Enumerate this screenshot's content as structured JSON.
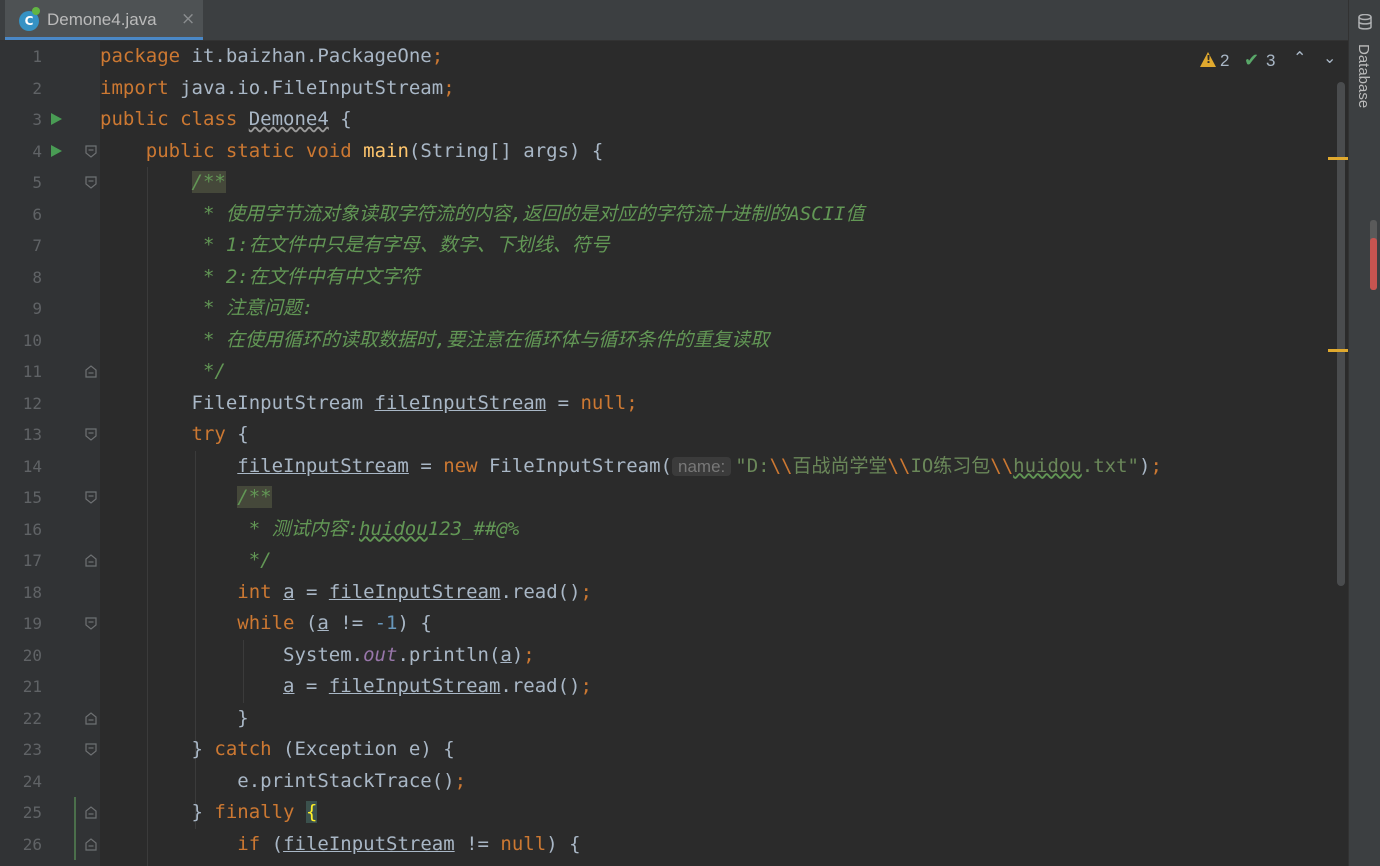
{
  "tab": {
    "filename": "Demone4.java",
    "close": "×",
    "icon": "java-class-icon"
  },
  "inspections": {
    "warnings": "2",
    "ok": "3",
    "up": "⌃",
    "down": "⌄"
  },
  "sidebar": {
    "label": "Database"
  },
  "hint": {
    "name": "name:"
  },
  "line_numbers": [
    "1",
    "2",
    "3",
    "4",
    "5",
    "6",
    "7",
    "8",
    "9",
    "10",
    "11",
    "12",
    "13",
    "14",
    "15",
    "16",
    "17",
    "18",
    "19",
    "20",
    "21",
    "22",
    "23",
    "24",
    "25",
    "26"
  ],
  "code": {
    "l1": {
      "kw": "package",
      "rest": " it.baizhan.PackageOne",
      "semi": ";"
    },
    "l2": {
      "kw": "import",
      "rest": " java.io.FileInputStream",
      "semi": ";"
    },
    "l3": {
      "kw": "public class",
      "name": "Demone4",
      "rest": " {"
    },
    "l4": {
      "kw": "public static void",
      "fn": "main",
      "rest": "(String[] args) {"
    },
    "l5": {
      "doc": "/**"
    },
    "l6": {
      "doc": " * 使用字节流对象读取字符流的内容,返回的是对应的字符流十进制的ASCII值"
    },
    "l7": {
      "doc": " * 1:在文件中只是有字母、数字、下划线、符号"
    },
    "l8": {
      "doc": " * 2:在文件中有中文字符"
    },
    "l9": {
      "doc": " * 注意问题:"
    },
    "l10": {
      "doc": " * 在使用循环的读取数据时,要注意在循环体与循环条件的重复读取"
    },
    "l11": {
      "doc": " */"
    },
    "l12": {
      "type": "FileInputStream ",
      "var": "fileInputStream",
      "eq": " = ",
      "kw": "null",
      "semi": ";"
    },
    "l13": {
      "kw": "try",
      "rest": " {"
    },
    "l14": {
      "var": "fileInputStream",
      "eq": " = ",
      "kw": "new",
      "rest": " FileInputStream(",
      "str1": "\"D:",
      "esc1": "\\\\",
      "str2": "百战尚学堂",
      "esc2": "\\\\",
      "str3": "IO练习包",
      "esc3": "\\\\",
      "str4": "huidou",
      "str5": ".txt\"",
      "end": ")",
      "semi": ";"
    },
    "l15": {
      "doc": "/**"
    },
    "l16": {
      "doc": " * 测试内容:",
      "doc2": "huidou",
      "doc3": "123_##@%"
    },
    "l17": {
      "doc": " */"
    },
    "l18": {
      "kw": "int",
      "sp": " ",
      "var": "a",
      "eq": " = ",
      "var2": "fileInputStream",
      "rest": ".read()",
      "semi": ";"
    },
    "l19": {
      "kw": "while",
      "rest": " (",
      "var": "a",
      "rest2": " != ",
      "num": "-1",
      "rest3": ") {"
    },
    "l20": {
      "rest": "System.",
      "stat": "out",
      "rest2": ".println(",
      "var": "a",
      "rest3": ")",
      "semi": ";"
    },
    "l21": {
      "var": "a",
      "eq": " = ",
      "var2": "fileInputStream",
      "rest": ".read()",
      "semi": ";"
    },
    "l22": {
      "rest": "}"
    },
    "l23": {
      "rest": "} ",
      "kw": "catch",
      "rest2": " (Exception e) {"
    },
    "l24": {
      "rest": "e.printStackTrace()",
      "semi": ";"
    },
    "l25": {
      "rest": "} ",
      "kw": "finally",
      "brace": "{"
    },
    "l26": {
      "kw": "if",
      "rest": " (",
      "var": "fileInputStream",
      "rest2": " != ",
      "kw2": "null",
      "rest3": ") {"
    }
  }
}
